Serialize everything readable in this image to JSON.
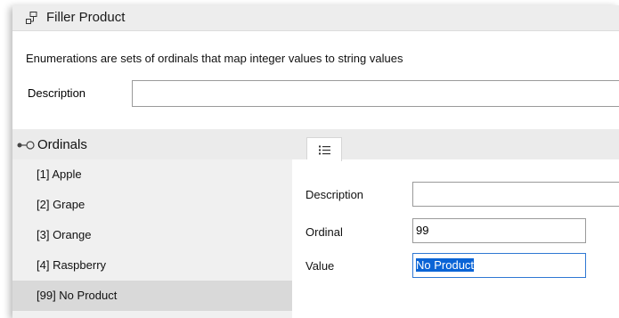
{
  "window": {
    "title": "Filler Product",
    "title_icon": "node-tree-icon",
    "intro_text": "Enumerations are sets of ordinals that map integer values to string values",
    "description_label": "Description",
    "description_value": ""
  },
  "ordinals": {
    "header": "Ordinals",
    "header_icon": "pin-circle-icon",
    "items": [
      {
        "label": "[1] Apple",
        "selected": false
      },
      {
        "label": "[2] Grape",
        "selected": false
      },
      {
        "label": "[3] Orange",
        "selected": false
      },
      {
        "label": "[4] Raspberry",
        "selected": false
      },
      {
        "label": "[99] No Product",
        "selected": true
      }
    ]
  },
  "properties": {
    "tab_icon": "list-icon",
    "description_label": "Description",
    "description_value": "",
    "ordinal_label": "Ordinal",
    "ordinal_value": "99",
    "value_label": "Value",
    "value_value": "No Product"
  },
  "colors": {
    "selection": "#0a64d6",
    "focus_border": "#2f78d3",
    "list_bg": "#f0f0f0",
    "list_selected_bg": "#d9d9d9"
  }
}
